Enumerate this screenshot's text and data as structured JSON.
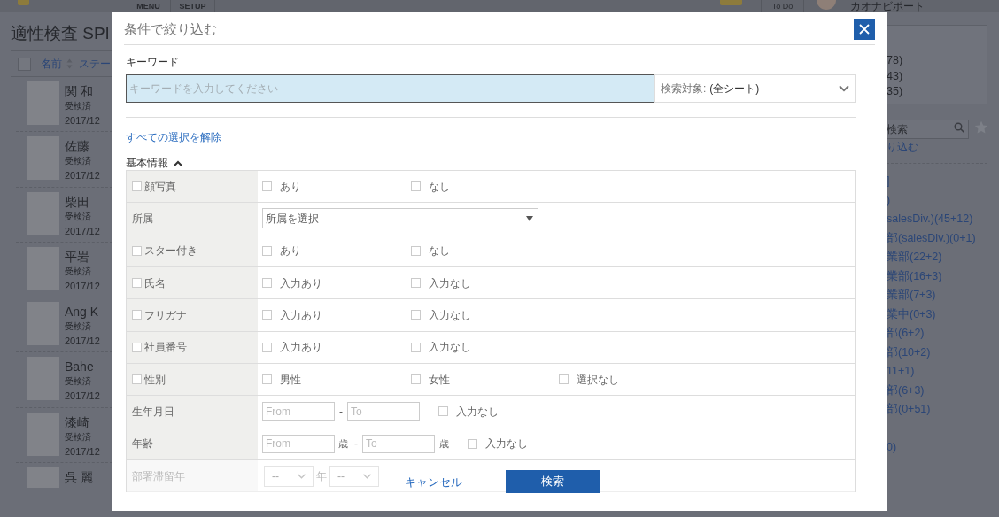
{
  "top_bar": {
    "menus": [
      "MENU",
      "SETUP"
    ],
    "todo": "To Do",
    "user": "カオナビポート"
  },
  "page": {
    "title": "適性検査 SPI",
    "select_all": {
      "checked": false
    },
    "columns": [
      "名前",
      "ステー"
    ],
    "people": [
      {
        "name": "関 和",
        "status": "受検済",
        "date": "2017/12"
      },
      {
        "name": "佐藤",
        "status": "受検済",
        "date": "2017/12"
      },
      {
        "name": "柴田",
        "status": "受検済",
        "date": "2017/12"
      },
      {
        "name": "平岩",
        "status": "受検済",
        "date": "2017/12"
      },
      {
        "name": "Ang K",
        "status": "受検済",
        "date": "2017/12"
      },
      {
        "name": "Bahe",
        "status": "受検済",
        "date": "2017/12"
      },
      {
        "name": "漆崎",
        "status": "受検済",
        "date": "2017/12"
      },
      {
        "name": "呉 麗"
      }
    ]
  },
  "sidebar": {
    "counts": [
      "78)",
      "43)",
      "35)"
    ],
    "search": {
      "placeholder": "検索"
    },
    "filter_link": "り込む",
    "link_groups": [
      [
        "]",
        ")",
        "salesDiv.)(45+12)",
        "部(salesDiv.)(0+1)",
        "業部(22+2)",
        "業部(16+3)",
        "業部(7+3)",
        "業中(0+3)",
        "部(6+2)",
        "部(10+2)",
        "11+1)",
        "部(6+3)",
        "部(0+51)"
      ],
      [
        "0)"
      ]
    ]
  },
  "dialog": {
    "title": "条件で絞り込む",
    "keyword_label": "キーワード",
    "keyword": {
      "placeholder": "キーワードを入力してください"
    },
    "scope": {
      "label": "検索対象:",
      "value": "(全シート)"
    },
    "clear_link": "すべての選択を解除",
    "section": {
      "title": "基本情報",
      "expanded": true
    },
    "rows": [
      {
        "kind": "options",
        "label": "顔写真",
        "checked": false,
        "options": [
          {
            "label": "あり",
            "checked": false
          },
          {
            "label": "なし",
            "checked": false
          }
        ]
      },
      {
        "kind": "select",
        "label": "所属",
        "value": "所属を選択"
      },
      {
        "kind": "options",
        "label": "スター付き",
        "checked": false,
        "options": [
          {
            "label": "あり",
            "checked": false
          },
          {
            "label": "なし",
            "checked": false
          }
        ]
      },
      {
        "kind": "options",
        "label": "氏名",
        "checked": false,
        "options": [
          {
            "label": "入力あり",
            "checked": false
          },
          {
            "label": "入力なし",
            "checked": false
          }
        ]
      },
      {
        "kind": "options",
        "label": "フリガナ",
        "checked": false,
        "options": [
          {
            "label": "入力あり",
            "checked": false
          },
          {
            "label": "入力なし",
            "checked": false
          }
        ]
      },
      {
        "kind": "options",
        "label": "社員番号",
        "checked": false,
        "options": [
          {
            "label": "入力あり",
            "checked": false
          },
          {
            "label": "入力なし",
            "checked": false
          }
        ]
      },
      {
        "kind": "options",
        "label": "性別",
        "checked": false,
        "options": [
          {
            "label": "男性",
            "checked": false
          },
          {
            "label": "女性",
            "checked": false
          },
          {
            "label": "選択なし",
            "checked": false
          }
        ]
      },
      {
        "kind": "range",
        "label": "生年月日",
        "from": {
          "placeholder": "From"
        },
        "separator": "-",
        "to": {
          "placeholder": "To"
        },
        "empty_option": {
          "label": "入力なし",
          "checked": false
        }
      },
      {
        "kind": "range",
        "label": "年齢",
        "from": {
          "placeholder": "From",
          "unit": "歳"
        },
        "separator": "-",
        "to": {
          "placeholder": "To",
          "unit": "歳"
        },
        "empty_option": {
          "label": "入力なし",
          "checked": false
        }
      },
      {
        "kind": "period",
        "label": "部署滞留年",
        "parts": [
          {
            "kind": "select",
            "value": "--"
          },
          {
            "kind": "unit",
            "text": "年"
          },
          {
            "kind": "select",
            "value": "--"
          }
        ]
      }
    ],
    "buttons": {
      "cancel": "キャンセル",
      "search": "検索"
    }
  }
}
